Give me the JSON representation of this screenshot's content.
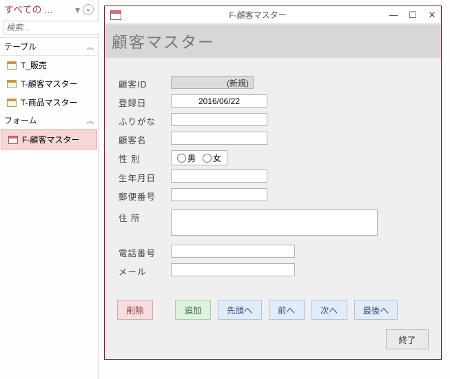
{
  "nav": {
    "title": "すべての ...",
    "search_placeholder": "検索...",
    "groups": [
      {
        "label": "テーブル",
        "items": [
          {
            "icon": "table",
            "label": "T_販売"
          },
          {
            "icon": "table",
            "label": "T-顧客マスター"
          },
          {
            "icon": "table",
            "label": "T-商品マスター"
          }
        ]
      },
      {
        "label": "フォーム",
        "items": [
          {
            "icon": "form",
            "label": "F-顧客マスター",
            "selected": true
          }
        ]
      }
    ]
  },
  "window": {
    "title": "F-顧客マスター",
    "banner": "顧客マスター",
    "fields": {
      "id_label": "顧客ID",
      "id_value": "(新規)",
      "date_label": "登録日",
      "date_value": "2016/06/22",
      "furigana_label": "ふりがな",
      "furigana_value": "",
      "name_label": "顧客名",
      "name_value": "",
      "gender_label": "性  別",
      "gender_male": "男",
      "gender_female": "女",
      "birth_label": "生年月日",
      "birth_value": "",
      "zip_label": "郵便番号",
      "zip_value": "",
      "addr_label": "住  所",
      "addr_value": "",
      "phone_label": "電話番号",
      "phone_value": "",
      "mail_label": "メール",
      "mail_value": ""
    },
    "buttons": {
      "delete": "削除",
      "add": "追加",
      "first": "先頭へ",
      "prev": "前へ",
      "next": "次へ",
      "last": "最後へ",
      "close": "終了"
    }
  }
}
